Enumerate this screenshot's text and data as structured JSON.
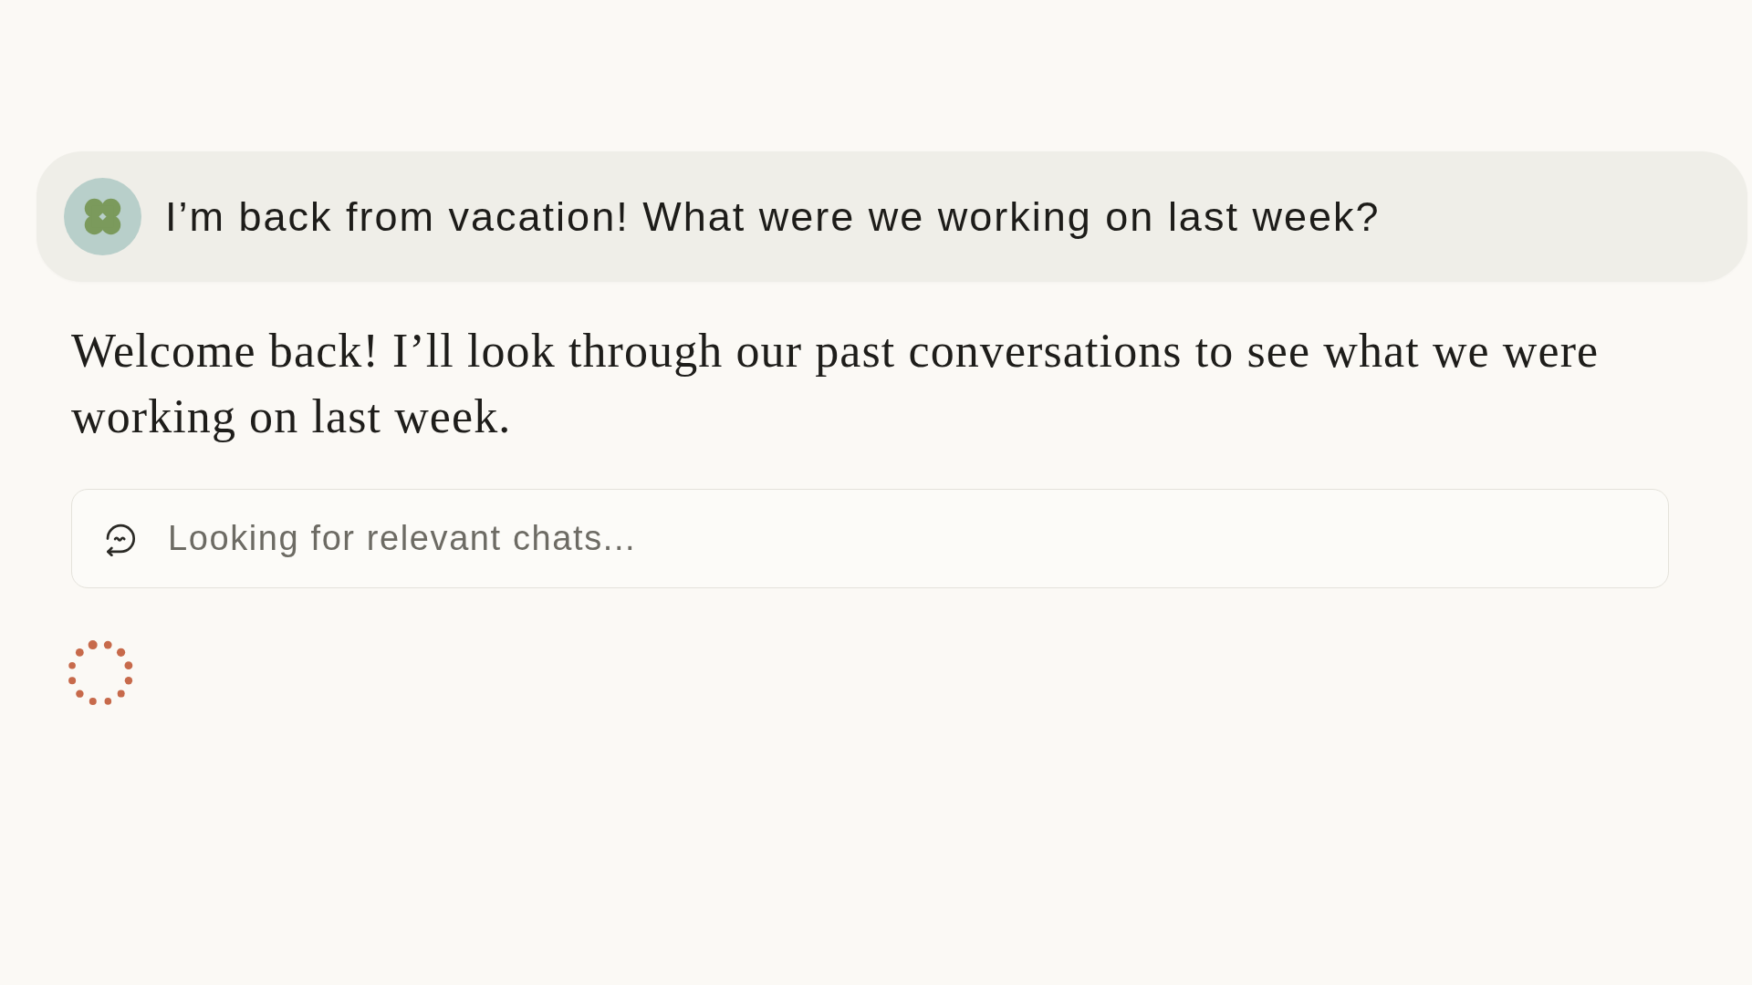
{
  "user_message": {
    "text": "I’m back from vacation! What were we working on last week?"
  },
  "assistant_message": {
    "text": "Welcome back! I’ll look through our past conversations to see what we were working on last week.",
    "loading": true
  },
  "tool_status": {
    "text": "Looking for relevant chats..."
  }
}
